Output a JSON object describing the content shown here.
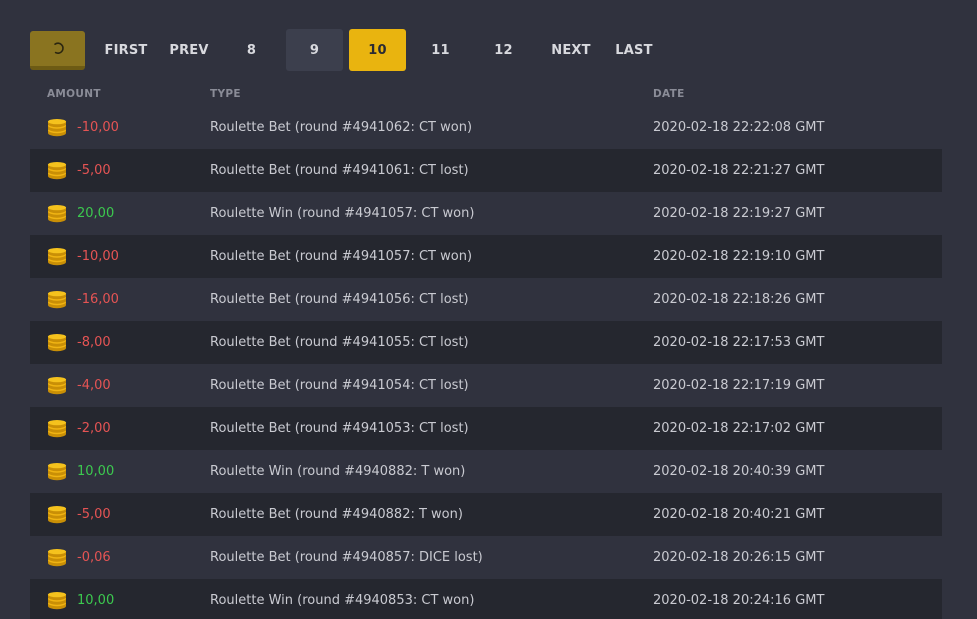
{
  "pagination": {
    "first_label": "FIRST",
    "prev_label": "PREV",
    "pages": [
      "8",
      "9",
      "10",
      "11",
      "12"
    ],
    "active_page": "10",
    "next_label": "NEXT",
    "last_label": "LAST"
  },
  "table": {
    "headers": {
      "amount": "AMOUNT",
      "type": "TYPE",
      "date": "DATE"
    },
    "rows": [
      {
        "amount": "-10,00",
        "sign": "neg",
        "type": "Roulette Bet (round #4941062: CT won)",
        "date": "2020-02-18 22:22:08 GMT"
      },
      {
        "amount": "-5,00",
        "sign": "neg",
        "type": "Roulette Bet (round #4941061: CT lost)",
        "date": "2020-02-18 22:21:27 GMT"
      },
      {
        "amount": "20,00",
        "sign": "pos",
        "type": "Roulette Win (round #4941057: CT won)",
        "date": "2020-02-18 22:19:27 GMT"
      },
      {
        "amount": "-10,00",
        "sign": "neg",
        "type": "Roulette Bet (round #4941057: CT won)",
        "date": "2020-02-18 22:19:10 GMT"
      },
      {
        "amount": "-16,00",
        "sign": "neg",
        "type": "Roulette Bet (round #4941056: CT lost)",
        "date": "2020-02-18 22:18:26 GMT"
      },
      {
        "amount": "-8,00",
        "sign": "neg",
        "type": "Roulette Bet (round #4941055: CT lost)",
        "date": "2020-02-18 22:17:53 GMT"
      },
      {
        "amount": "-4,00",
        "sign": "neg",
        "type": "Roulette Bet (round #4941054: CT lost)",
        "date": "2020-02-18 22:17:19 GMT"
      },
      {
        "amount": "-2,00",
        "sign": "neg",
        "type": "Roulette Bet (round #4941053: CT lost)",
        "date": "2020-02-18 22:17:02 GMT"
      },
      {
        "amount": "10,00",
        "sign": "pos",
        "type": "Roulette Win (round #4940882: T won)",
        "date": "2020-02-18 20:40:39 GMT"
      },
      {
        "amount": "-5,00",
        "sign": "neg",
        "type": "Roulette Bet (round #4940882: T won)",
        "date": "2020-02-18 20:40:21 GMT"
      },
      {
        "amount": "-0,06",
        "sign": "neg",
        "type": "Roulette Bet (round #4940857: DICE lost)",
        "date": "2020-02-18 20:26:15 GMT"
      },
      {
        "amount": "10,00",
        "sign": "pos",
        "type": "Roulette Win (round #4940853: CT won)",
        "date": "2020-02-18 20:24:16 GMT"
      }
    ]
  },
  "icons": {
    "refresh": "refresh-icon",
    "coin": "coin-stack-icon"
  },
  "colors": {
    "accent": "#e9b40f",
    "negative": "#e55454",
    "positive": "#3cc94f",
    "background": "#30323e",
    "row_alt": "#25272f"
  }
}
